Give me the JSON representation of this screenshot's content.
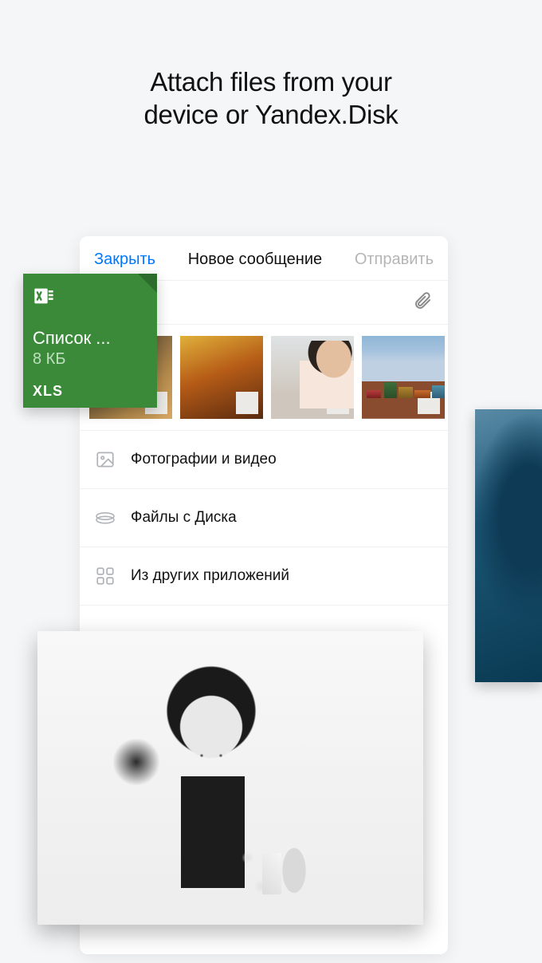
{
  "headline_line1": "Attach files from your",
  "headline_line2": "device or Yandex.Disk",
  "toolbar": {
    "close": "Закрыть",
    "title": "Новое сообщение",
    "send": "Отправить"
  },
  "xls": {
    "filename": "Список ...",
    "size": "8 КБ",
    "ext": "XLS"
  },
  "menu": {
    "photos": "Фотографии и видео",
    "disk": "Файлы с Диска",
    "other": "Из других приложений"
  }
}
